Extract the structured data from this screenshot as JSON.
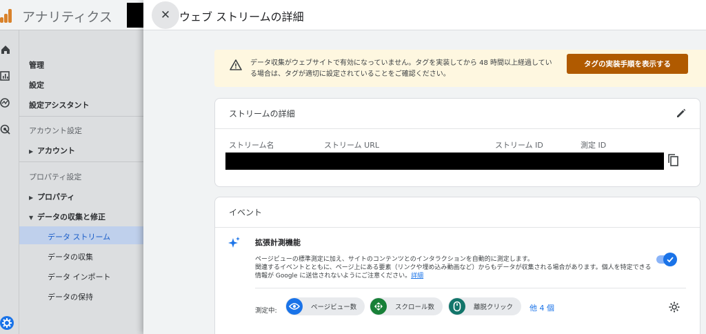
{
  "background": {
    "app_title": "アナリティクス",
    "nav": {
      "items": [
        {
          "label": "管理"
        },
        {
          "label": "設定"
        },
        {
          "label": "設定アシスタント"
        }
      ],
      "sections": [
        {
          "label": "アカウント設定"
        },
        {
          "label": "プロパティ設定"
        }
      ],
      "account": "アカウント",
      "property": "プロパティ",
      "data_collection": "データの収集と修正",
      "sub_items": [
        {
          "label": "データ ストリーム"
        },
        {
          "label": "データの収集"
        },
        {
          "label": "データ インポート"
        },
        {
          "label": "データの保持"
        }
      ]
    }
  },
  "panel": {
    "title": "ウェブ ストリームの詳細",
    "banner": {
      "message": "データ収集がウェブサイトで有効になっていません。タグを実装してから 48 時間以上経過している場合は、タグが適切に設定されていることをご確認ください。",
      "button_label": "タグの実装手順を表示する"
    },
    "stream_details": {
      "title": "ストリームの詳細",
      "columns": [
        "ストリーム名",
        "ストリーム URL",
        "ストリーム ID",
        "測定 ID"
      ]
    },
    "events": {
      "title": "イベント",
      "enhanced": {
        "title": "拡張計測機能",
        "desc_line1": "ページビューの標準測定に加え、サイトのコンテンツとのインタラクションを自動的に測定します。",
        "desc_line2": "関連するイベントとともに、ページ上にある要素（リンクや埋め込み動画など）からもデータが収集される場合があります。個人を特定できる情報が Google に送信されないようにご注意ください。",
        "link": "詳細",
        "toggle_on": true
      },
      "measuring_label": "測定中:",
      "chips": [
        {
          "label": "ページビュー数",
          "icon": "eye-icon"
        },
        {
          "label": "スクロール数",
          "icon": "scroll-icon"
        },
        {
          "label": "離脱クリック",
          "icon": "mouse-icon"
        }
      ],
      "more": "他 4 個"
    }
  },
  "colors": {
    "accent": "#1a73e8",
    "warning_bg": "#fef7e0",
    "warning_button": "#b05a00"
  }
}
